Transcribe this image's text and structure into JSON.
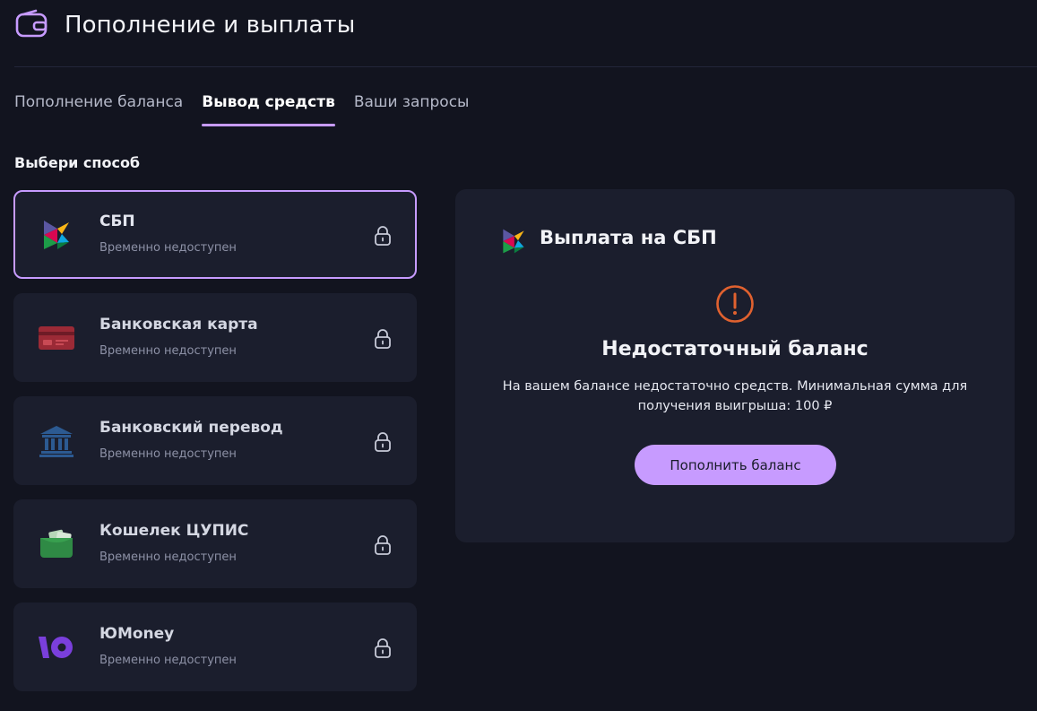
{
  "header": {
    "title": "Пополнение и выплаты",
    "icon": "wallet-icon"
  },
  "tabs": [
    {
      "label": "Пополнение баланса",
      "active": false
    },
    {
      "label": "Вывод средств",
      "active": true
    },
    {
      "label": "Ваши запросы",
      "active": false
    }
  ],
  "section_label": "Выбери способ",
  "methods": [
    {
      "name": "СБП",
      "status": "Временно недоступен",
      "icon": "sbp-logo-icon",
      "selected": true
    },
    {
      "name": "Банковская карта",
      "status": "Временно недоступен",
      "icon": "bank-card-icon",
      "selected": false
    },
    {
      "name": "Банковский перевод",
      "status": "Временно недоступен",
      "icon": "bank-building-icon",
      "selected": false
    },
    {
      "name": "Кошелек ЦУПИС",
      "status": "Временно недоступен",
      "icon": "wallet-cupis-icon",
      "selected": false
    },
    {
      "name": "ЮMoney",
      "status": "Временно недоступен",
      "icon": "yumoney-logo-icon",
      "selected": false
    }
  ],
  "panel": {
    "title": "Выплата на СБП",
    "error_title": "Недостаточный баланс",
    "error_text": "На вашем балансе недостаточно средств. Минимальная сумма для получения выигрыша: 100 ₽",
    "button_label": "Пополнить баланс"
  },
  "colors": {
    "background": "#12141f",
    "card": "#1b1e2d",
    "accent": "#c79bff",
    "warning": "#e0612f"
  }
}
